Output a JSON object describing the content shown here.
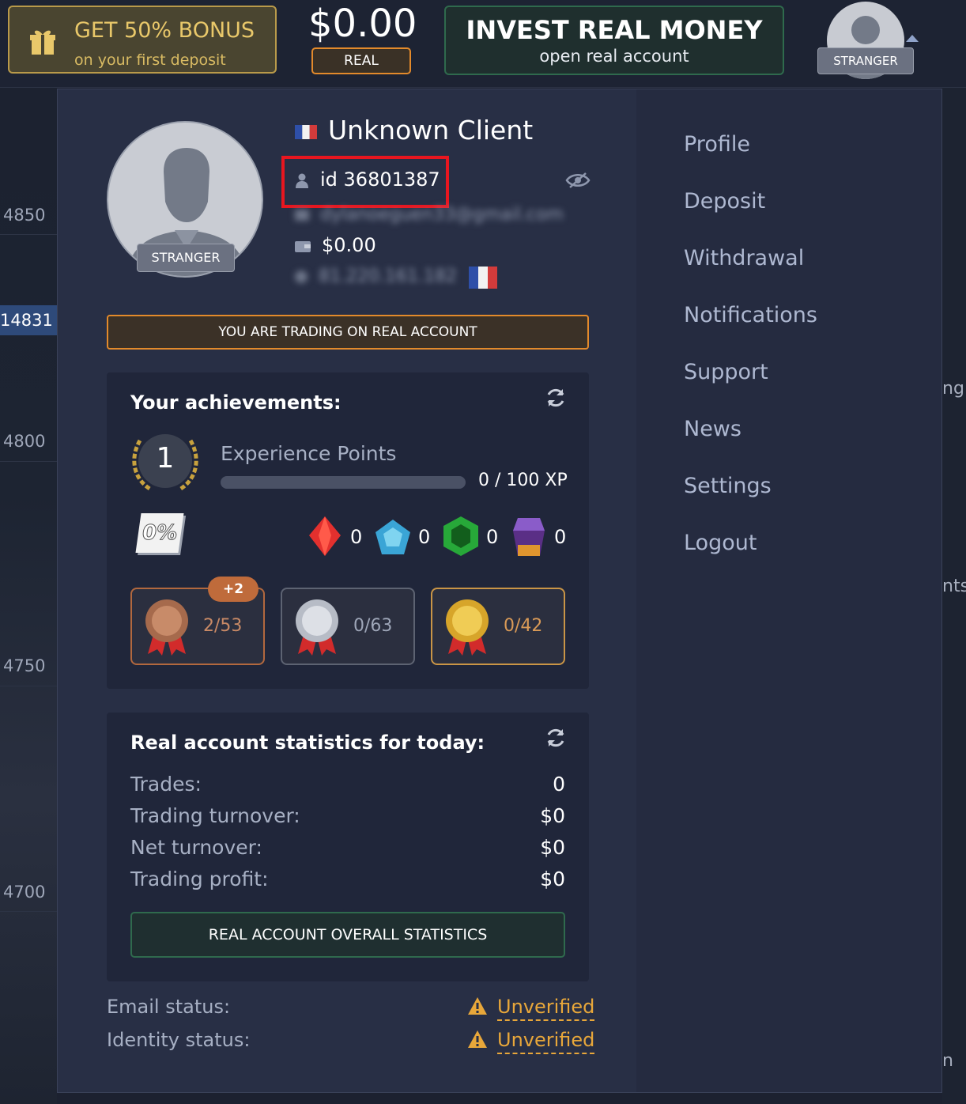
{
  "header": {
    "bonus_title": "GET 50% BONUS",
    "bonus_subtitle": "on your first deposit",
    "balance": "$0.00",
    "account_type": "REAL",
    "invest_title": "INVEST REAL MONEY",
    "invest_subtitle": "open real account",
    "user_badge": "STRANGER"
  },
  "chart_axis": {
    "labels": [
      "4850",
      "14831",
      "4800",
      "4750",
      "4700"
    ],
    "right_fragments": [
      "ng",
      "nts",
      "n"
    ]
  },
  "profile": {
    "name": "Unknown Client",
    "id_text": "id 36801387",
    "email_blurred": "dylanoeguen33@gmail.com",
    "balance": "$0.00",
    "ip_blurred": "81.220.161.182",
    "badge": "STRANGER",
    "trading_notice": "YOU ARE TRADING ON REAL ACCOUNT"
  },
  "achievements": {
    "title": "Your achievements:",
    "level": "1",
    "xp_label": "Experience Points",
    "xp_value": "0 / 100 XP",
    "xp_progress": 0,
    "discount_icon_text": "0%",
    "gems": [
      {
        "name": "ruby",
        "count": "0"
      },
      {
        "name": "sapphire",
        "count": "0"
      },
      {
        "name": "emerald",
        "count": "0"
      },
      {
        "name": "amethyst",
        "count": "0"
      }
    ],
    "medals": [
      {
        "name": "bronze",
        "count": "2/53",
        "badge": "+2"
      },
      {
        "name": "silver",
        "count": "0/63"
      },
      {
        "name": "gold",
        "count": "0/42"
      }
    ]
  },
  "stats": {
    "title": "Real account statistics for today:",
    "rows": [
      {
        "label": "Trades:",
        "value": "0"
      },
      {
        "label": "Trading turnover:",
        "value": "$0"
      },
      {
        "label": "Net turnover:",
        "value": "$0"
      },
      {
        "label": "Trading profit:",
        "value": "$0"
      }
    ],
    "overall_button": "REAL ACCOUNT OVERALL STATISTICS"
  },
  "verification": {
    "email_label": "Email status:",
    "email_value": "Unverified",
    "identity_label": "Identity status:",
    "identity_value": "Unverified"
  },
  "menu": {
    "items": [
      "Profile",
      "Deposit",
      "Withdrawal",
      "Notifications",
      "Support",
      "News",
      "Settings",
      "Logout"
    ]
  },
  "colors": {
    "accent_orange": "#e38a2b",
    "accent_green": "#2f6a4d",
    "highlight_red": "#e8161f",
    "warning": "#e8a73a"
  }
}
